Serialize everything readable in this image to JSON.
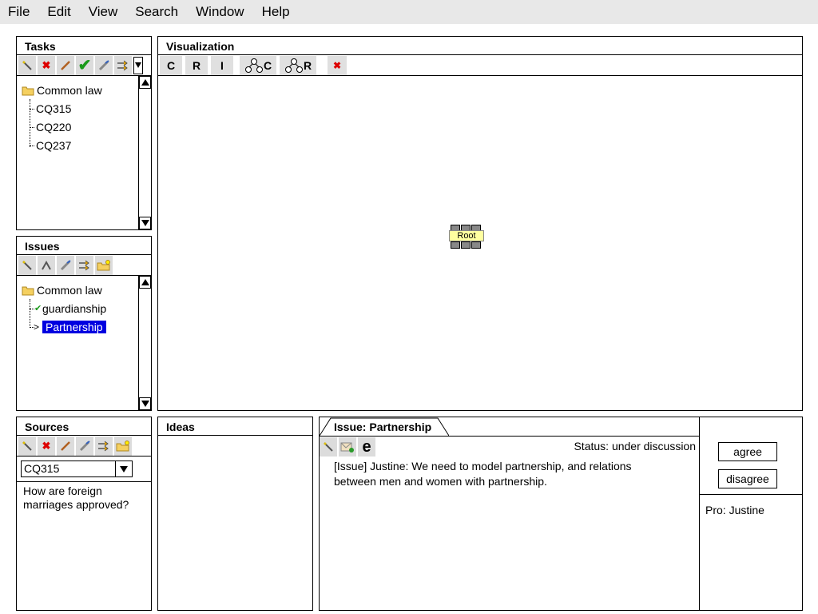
{
  "menu": [
    "File",
    "Edit",
    "View",
    "Search",
    "Window",
    "Help"
  ],
  "tasks": {
    "title": "Tasks",
    "tree": {
      "root": "Common law",
      "children": [
        "CQ315",
        "CQ220",
        "CQ237"
      ]
    }
  },
  "issues": {
    "title": "Issues",
    "tree": {
      "root": "Common law",
      "children": [
        {
          "label": "guardianship",
          "status": "check"
        },
        {
          "label": "Partnership",
          "status": "selected"
        }
      ]
    }
  },
  "sources": {
    "title": "Sources",
    "selected": "CQ315",
    "text": "How are foreign marriages approved?"
  },
  "visualization": {
    "title": "Visualization",
    "buttons": [
      "C",
      "R",
      "I",
      "C",
      "R"
    ],
    "node_label": "Root"
  },
  "ideas": {
    "title": "Ideas"
  },
  "issue_detail": {
    "tab": "Issue: Partnership",
    "status": "Status: under discussion",
    "text": "[Issue] Justine: We need to model partnership, and relations between men and women with partnership.",
    "agree": "agree",
    "disagree": "disagree",
    "pro": "Pro: Justine"
  },
  "colors": {
    "selection": "#0000e0",
    "menubar": "#e8e8e8",
    "toolbar_button": "#dcdcdc",
    "root_node": "#ffffa0"
  },
  "icons": [
    "wand-icon",
    "delete-icon",
    "pencil-icon",
    "check-icon",
    "brush-icon",
    "arrows-icon",
    "folder-star-icon",
    "tree-c-icon",
    "tree-r-icon",
    "email-icon",
    "e-icon"
  ]
}
